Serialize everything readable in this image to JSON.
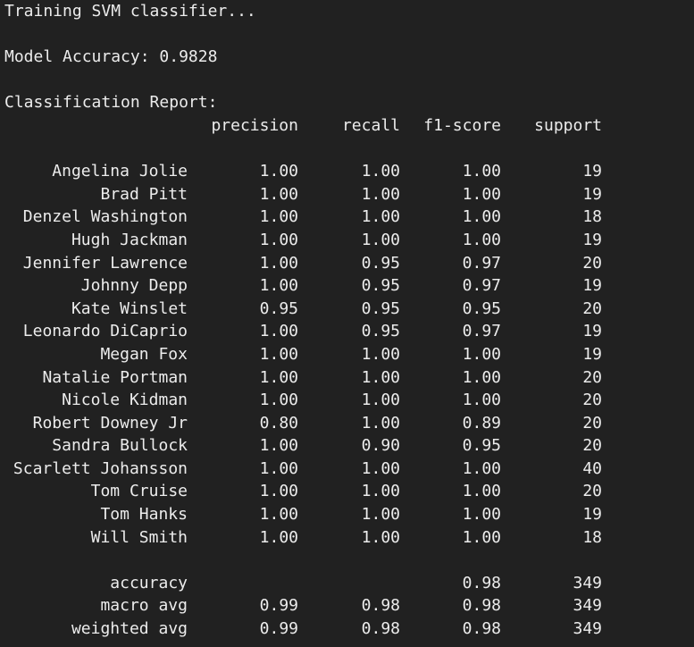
{
  "output": {
    "line1": "Training SVM classifier...",
    "accuracy_line": "Model Accuracy: 0.9828",
    "report_title": "Classification Report:"
  },
  "report": {
    "headers": [
      "precision",
      "recall",
      "f1-score",
      "support"
    ],
    "rows": [
      {
        "name": "Angelina Jolie",
        "precision": "1.00",
        "recall": "1.00",
        "f1": "1.00",
        "support": "19"
      },
      {
        "name": "Brad Pitt",
        "precision": "1.00",
        "recall": "1.00",
        "f1": "1.00",
        "support": "19"
      },
      {
        "name": "Denzel Washington",
        "precision": "1.00",
        "recall": "1.00",
        "f1": "1.00",
        "support": "18"
      },
      {
        "name": "Hugh Jackman",
        "precision": "1.00",
        "recall": "1.00",
        "f1": "1.00",
        "support": "19"
      },
      {
        "name": "Jennifer Lawrence",
        "precision": "1.00",
        "recall": "0.95",
        "f1": "0.97",
        "support": "20"
      },
      {
        "name": "Johnny Depp",
        "precision": "1.00",
        "recall": "0.95",
        "f1": "0.97",
        "support": "19"
      },
      {
        "name": "Kate Winslet",
        "precision": "0.95",
        "recall": "0.95",
        "f1": "0.95",
        "support": "20"
      },
      {
        "name": "Leonardo DiCaprio",
        "precision": "1.00",
        "recall": "0.95",
        "f1": "0.97",
        "support": "19"
      },
      {
        "name": "Megan Fox",
        "precision": "1.00",
        "recall": "1.00",
        "f1": "1.00",
        "support": "19"
      },
      {
        "name": "Natalie Portman",
        "precision": "1.00",
        "recall": "1.00",
        "f1": "1.00",
        "support": "20"
      },
      {
        "name": "Nicole Kidman",
        "precision": "1.00",
        "recall": "1.00",
        "f1": "1.00",
        "support": "20"
      },
      {
        "name": "Robert Downey Jr",
        "precision": "0.80",
        "recall": "1.00",
        "f1": "0.89",
        "support": "20"
      },
      {
        "name": "Sandra Bullock",
        "precision": "1.00",
        "recall": "0.90",
        "f1": "0.95",
        "support": "20"
      },
      {
        "name": "Scarlett Johansson",
        "precision": "1.00",
        "recall": "1.00",
        "f1": "1.00",
        "support": "40"
      },
      {
        "name": "Tom Cruise",
        "precision": "1.00",
        "recall": "1.00",
        "f1": "1.00",
        "support": "20"
      },
      {
        "name": "Tom Hanks",
        "precision": "1.00",
        "recall": "1.00",
        "f1": "1.00",
        "support": "19"
      },
      {
        "name": "Will Smith",
        "precision": "1.00",
        "recall": "1.00",
        "f1": "1.00",
        "support": "18"
      }
    ],
    "summary": [
      {
        "name": "accuracy",
        "precision": "",
        "recall": "",
        "f1": "0.98",
        "support": "349"
      },
      {
        "name": "macro avg",
        "precision": "0.99",
        "recall": "0.98",
        "f1": "0.98",
        "support": "349"
      },
      {
        "name": "weighted avg",
        "precision": "0.99",
        "recall": "0.98",
        "f1": "0.98",
        "support": "349"
      }
    ]
  },
  "colors": {
    "background": "#212121",
    "text": "#ececec"
  }
}
